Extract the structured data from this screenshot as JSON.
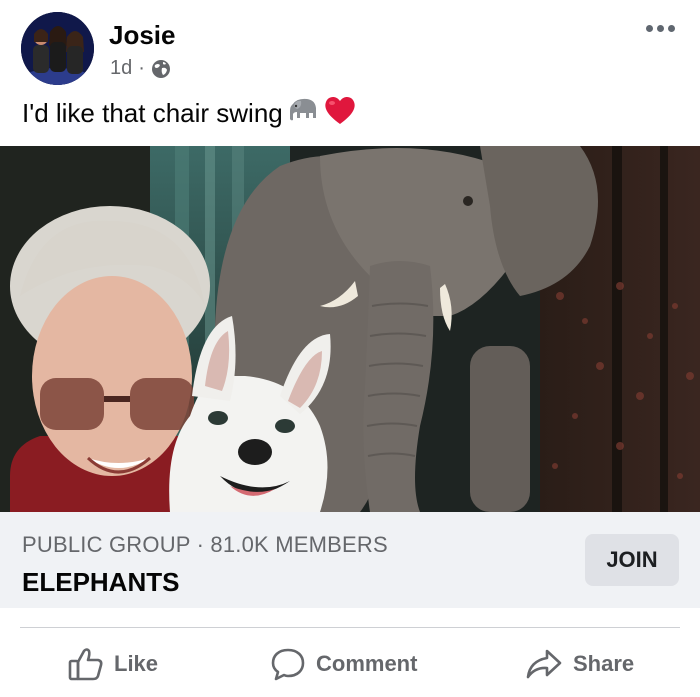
{
  "post": {
    "author": "Josie",
    "time": "1d",
    "separator": "·",
    "privacy_icon": "globe-icon",
    "more_icon": "ellipsis-icon",
    "text": "I'd like that chair swing",
    "emojis": [
      "elephant-emoji",
      "red-heart-emoji"
    ]
  },
  "group": {
    "meta": "PUBLIC GROUP · 81.0K MEMBERS",
    "name": "ELEPHANTS",
    "join_label": "JOIN"
  },
  "actions": {
    "like": "Like",
    "comment": "Comment",
    "share": "Share"
  },
  "colors": {
    "secondary_text": "#65676b",
    "group_bar": "#f0f2f5",
    "join_button": "#dfe1e6",
    "heart": "#e0173d"
  }
}
